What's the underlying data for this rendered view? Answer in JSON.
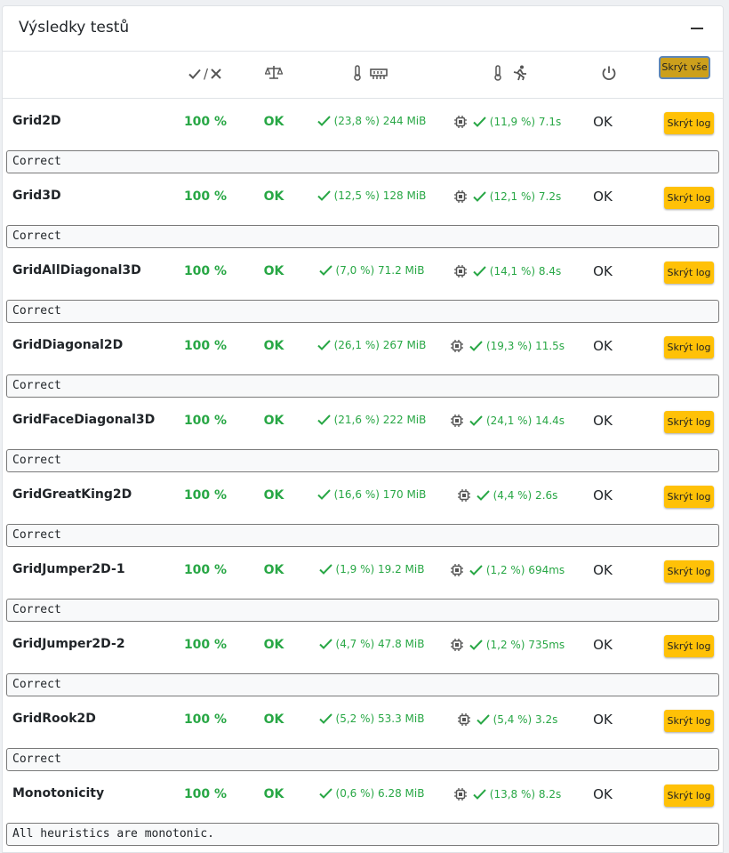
{
  "panel": {
    "title": "Výsledky testů"
  },
  "header": {
    "pass_fail_label": "/",
    "hide_all_label": "Skrýt vše"
  },
  "tests": [
    {
      "name": "Grid2D",
      "percent": "100 %",
      "result": "OK",
      "memory": "(23,8 %) 244 MiB",
      "time": "(11,9 %) 7.1s",
      "exit": "OK",
      "log_button": "Skrýt log",
      "log": "Correct"
    },
    {
      "name": "Grid3D",
      "percent": "100 %",
      "result": "OK",
      "memory": "(12,5 %) 128 MiB",
      "time": "(12,1 %) 7.2s",
      "exit": "OK",
      "log_button": "Skrýt log",
      "log": "Correct"
    },
    {
      "name": "GridAllDiagonal3D",
      "percent": "100 %",
      "result": "OK",
      "memory": "(7,0 %) 71.2 MiB",
      "time": "(14,1 %) 8.4s",
      "exit": "OK",
      "log_button": "Skrýt log",
      "log": "Correct"
    },
    {
      "name": "GridDiagonal2D",
      "percent": "100 %",
      "result": "OK",
      "memory": "(26,1 %) 267 MiB",
      "time": "(19,3 %) 11.5s",
      "exit": "OK",
      "log_button": "Skrýt log",
      "log": "Correct"
    },
    {
      "name": "GridFaceDiagonal3D",
      "percent": "100 %",
      "result": "OK",
      "memory": "(21,6 %) 222 MiB",
      "time": "(24,1 %) 14.4s",
      "exit": "OK",
      "log_button": "Skrýt log",
      "log": "Correct"
    },
    {
      "name": "GridGreatKing2D",
      "percent": "100 %",
      "result": "OK",
      "memory": "(16,6 %) 170 MiB",
      "time": "(4,4 %) 2.6s",
      "exit": "OK",
      "log_button": "Skrýt log",
      "log": "Correct"
    },
    {
      "name": "GridJumper2D-1",
      "percent": "100 %",
      "result": "OK",
      "memory": "(1,9 %) 19.2 MiB",
      "time": "(1,2 %) 694ms",
      "exit": "OK",
      "log_button": "Skrýt log",
      "log": "Correct"
    },
    {
      "name": "GridJumper2D-2",
      "percent": "100 %",
      "result": "OK",
      "memory": "(4,7 %) 47.8 MiB",
      "time": "(1,2 %) 735ms",
      "exit": "OK",
      "log_button": "Skrýt log",
      "log": "Correct"
    },
    {
      "name": "GridRook2D",
      "percent": "100 %",
      "result": "OK",
      "memory": "(5,2 %) 53.3 MiB",
      "time": "(5,4 %) 3.2s",
      "exit": "OK",
      "log_button": "Skrýt log",
      "log": "Correct"
    },
    {
      "name": "Monotonicity",
      "percent": "100 %",
      "result": "OK",
      "memory": "(0,6 %) 6.28 MiB",
      "time": "(13,8 %) 8.2s",
      "exit": "OK",
      "log_button": "Skrýt log",
      "log": "All heuristics are monotonic."
    }
  ]
}
